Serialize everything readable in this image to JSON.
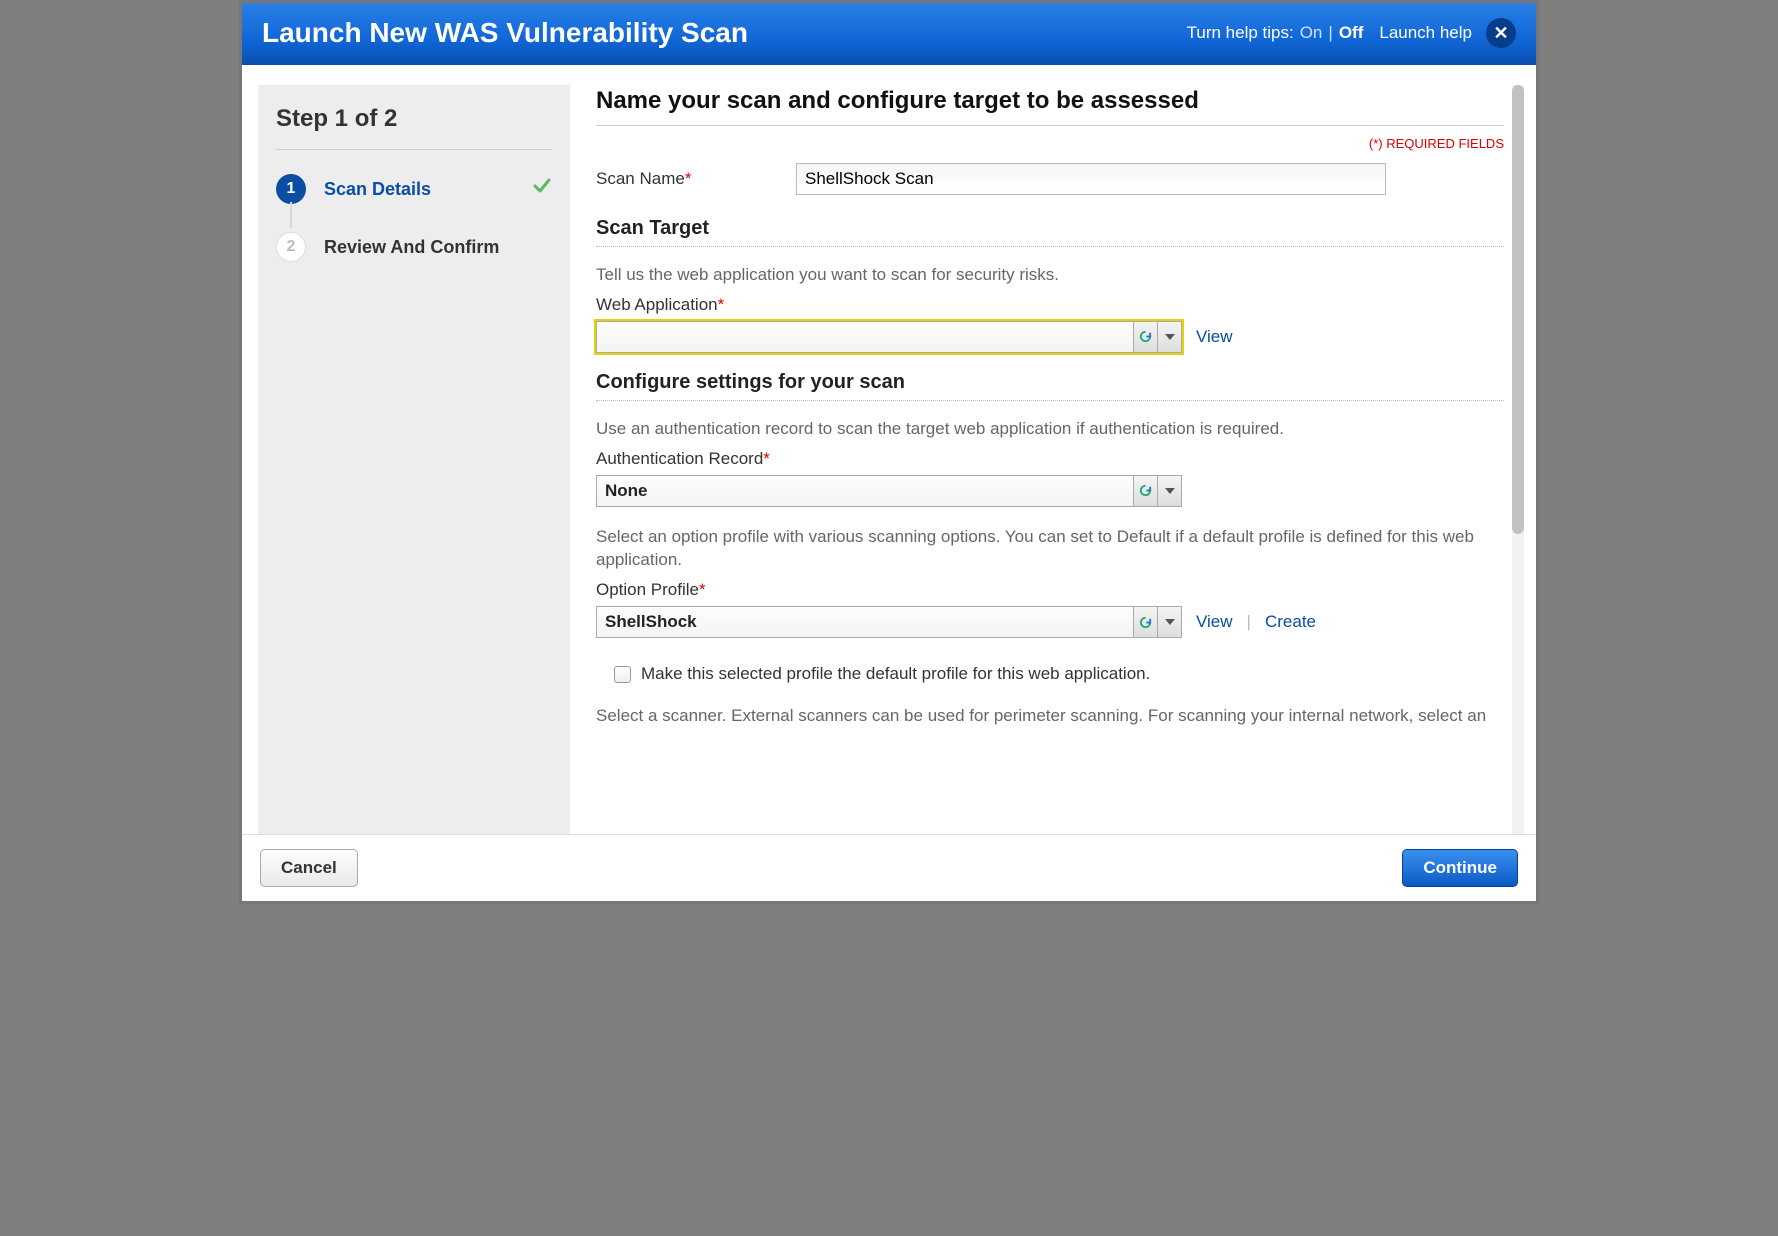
{
  "header": {
    "title": "Launch New WAS Vulnerability Scan",
    "help_tips_label": "Turn help tips:",
    "help_on": "On",
    "help_off": "Off",
    "launch_help": "Launch help"
  },
  "sidebar": {
    "step_title": "Step 1 of 2",
    "steps": [
      {
        "num": "1",
        "label": "Scan Details",
        "active": true,
        "checked": true
      },
      {
        "num": "2",
        "label": "Review And Confirm",
        "active": false,
        "checked": false
      }
    ]
  },
  "main": {
    "heading": "Name your scan and configure target to be assessed",
    "required_note": "(*) REQUIRED FIELDS",
    "scan_name_label": "Scan Name",
    "scan_name_value": "ShellShock Scan",
    "scan_target_heading": "Scan Target",
    "scan_target_desc": "Tell us the web application you want to scan for security risks.",
    "web_app_label": "Web Application",
    "web_app_value": "",
    "view_link": "View",
    "configure_heading": "Configure settings for your scan",
    "auth_desc": "Use an authentication record to scan the target web application if authentication is required.",
    "auth_label": "Authentication Record",
    "auth_value": "None",
    "profile_desc": "Select an option profile with various scanning options. You can set to Default if a default profile is defined for this web application.",
    "profile_label": "Option Profile",
    "profile_value": "ShellShock",
    "create_link": "Create",
    "default_profile_checkbox_label": "Make this selected profile the default profile for this web application.",
    "scanner_desc": "Select a scanner. External scanners can be used for perimeter scanning. For scanning your internal network, select an"
  },
  "footer": {
    "cancel": "Cancel",
    "continue": "Continue"
  }
}
